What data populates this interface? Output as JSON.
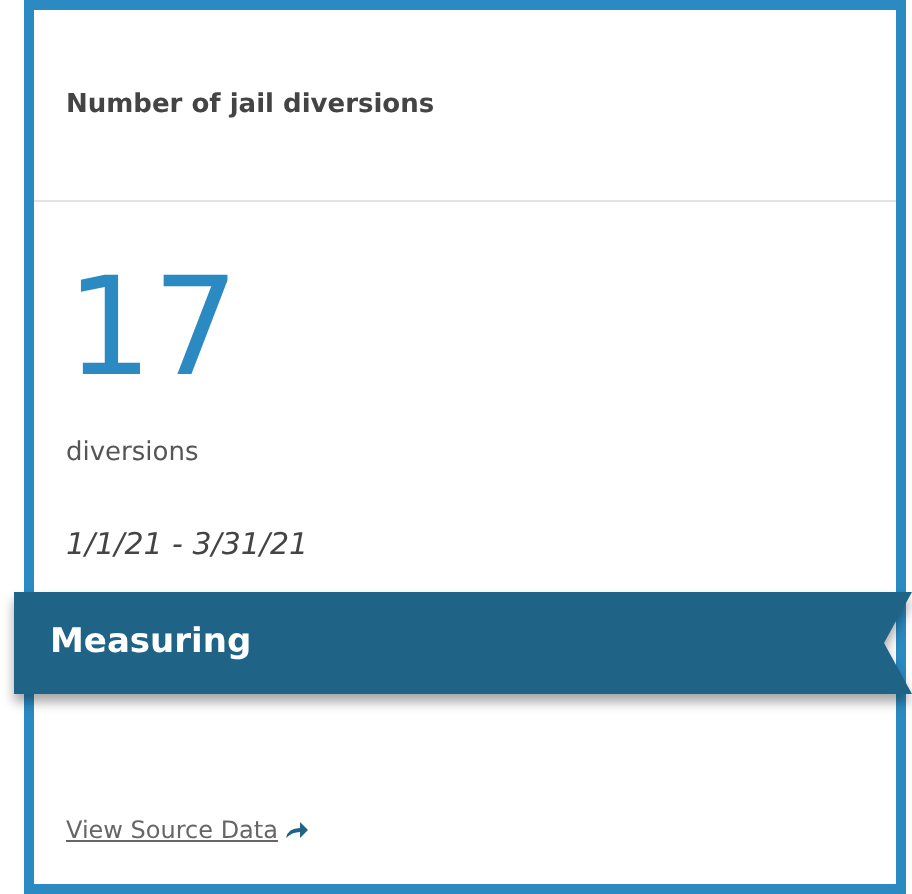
{
  "card": {
    "title": "Number of jail diversions",
    "value": "17",
    "unit": "diversions",
    "period": "1/1/21 - 3/31/21",
    "status": {
      "label": "Measuring"
    },
    "link": "View Source Data"
  }
}
